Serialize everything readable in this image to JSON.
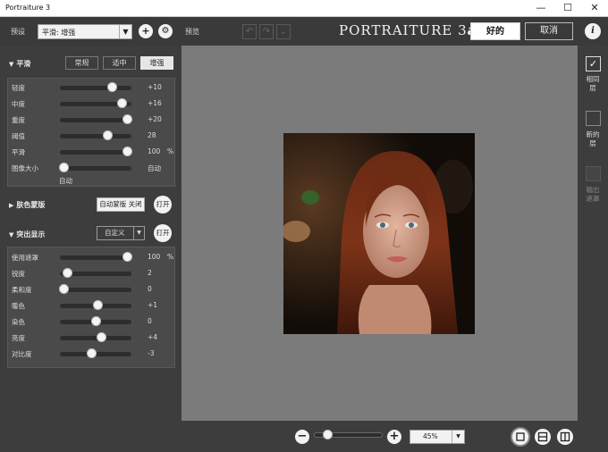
{
  "window": {
    "title": "Portraiture 3",
    "minimize_glyph": "—",
    "maximize_glyph": "☐",
    "close_glyph": "✕"
  },
  "toolbar": {
    "preset_label": "预设",
    "preset_value": "平滑: 增强",
    "add_glyph": "+",
    "settings_glyph": "⚙",
    "preview_label": "预览",
    "undo_glyph": "↶",
    "redo_glyph": "↷",
    "history_glyph": "⌄",
    "brand_name": "PORTRAITURE 3",
    "brand_suffix": "ai",
    "ok_label": "好的",
    "cancel_label": "取消",
    "info_glyph": "i"
  },
  "smoothing": {
    "title": "平滑",
    "modes": [
      "常规",
      "适中",
      "增强"
    ],
    "active_mode": "增强",
    "sliders": [
      {
        "label": "轻度",
        "value": "+10",
        "unit": "",
        "level": 0.72
      },
      {
        "label": "中度",
        "value": "+16",
        "unit": "",
        "level": 0.86
      },
      {
        "label": "重度",
        "value": "+20",
        "unit": "",
        "level": 0.94
      },
      {
        "label": "阈值",
        "value": "28",
        "unit": "",
        "level": 0.66
      },
      {
        "label": "平滑",
        "value": "100",
        "unit": "%",
        "level": 0.94
      },
      {
        "label": "图像大小",
        "value": "自动",
        "unit": "",
        "level": 0.05
      }
    ],
    "image_size_sub": "自动"
  },
  "skin_mask": {
    "title": "肤色蒙版",
    "auto_mask_label": "自动蒙版 关闭",
    "open_label": "打开"
  },
  "enhancements": {
    "title": "突出显示",
    "combo_value": "自定义",
    "open_label": "打开",
    "sliders": [
      {
        "label": "使用遮罩",
        "value": "100",
        "unit": "%",
        "level": 0.94
      },
      {
        "label": "锐度",
        "value": "2",
        "unit": "",
        "level": 0.1
      },
      {
        "label": "柔和度",
        "value": "0",
        "unit": "",
        "level": 0.05
      },
      {
        "label": "暖色",
        "value": "+1",
        "unit": "",
        "level": 0.52
      },
      {
        "label": "染色",
        "value": "0",
        "unit": "",
        "level": 0.5
      },
      {
        "label": "亮度",
        "value": "+4",
        "unit": "",
        "level": 0.58
      },
      {
        "label": "对比度",
        "value": "-3",
        "unit": "",
        "level": 0.44
      }
    ]
  },
  "layers": {
    "same_layer": "相同\n层",
    "new_layer": "新的\n层",
    "output_mask": "输出\n遮罩",
    "check_glyph": "✓"
  },
  "bottom": {
    "zoom_out_glyph": "−",
    "zoom_in_glyph": "+",
    "zoom_value": "45%",
    "zoom_level": 0.14
  }
}
